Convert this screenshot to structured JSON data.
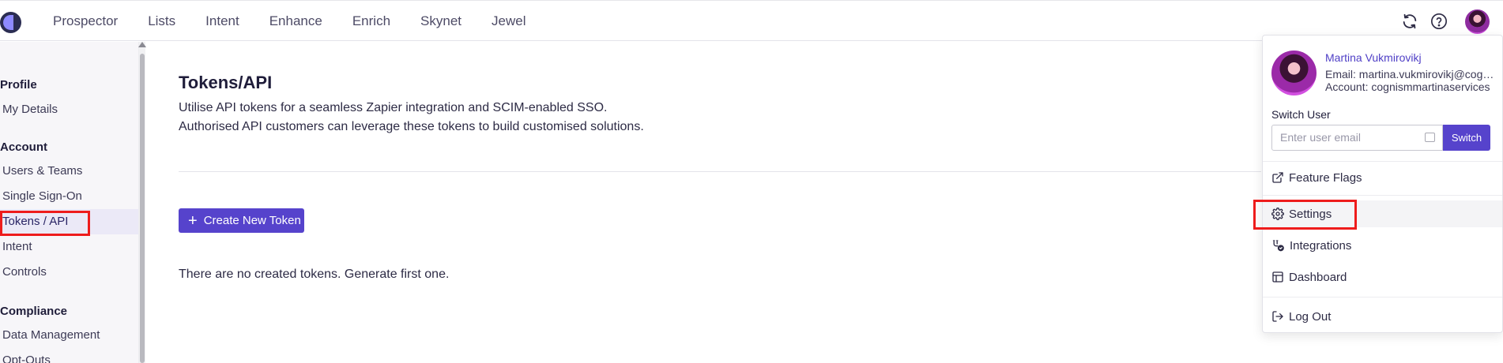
{
  "nav": {
    "items": [
      "Prospector",
      "Lists",
      "Intent",
      "Enhance",
      "Enrich",
      "Skynet",
      "Jewel"
    ]
  },
  "top_icons": {
    "refresh": "refresh-icon",
    "help": "help-icon",
    "avatar": "user-avatar"
  },
  "sidebar": {
    "sections": [
      {
        "heading": "Profile",
        "items": [
          "My Details"
        ]
      },
      {
        "heading": "Account",
        "items": [
          "Users & Teams",
          "Single Sign-On",
          "Tokens / API",
          "Intent",
          "Controls"
        ]
      },
      {
        "heading": "Compliance",
        "items": [
          "Data Management",
          "Opt-Outs"
        ]
      }
    ],
    "active_item": "Tokens / API"
  },
  "main": {
    "title": "Tokens/API",
    "description_line1": "Utilise API tokens for a seamless Zapier integration and SCIM-enabled SSO.",
    "description_line2": "Authorised API customers can leverage these tokens to build customised solutions.",
    "create_button_label": "Create New Token",
    "empty_message": "There are no created tokens. Generate first one."
  },
  "user_menu": {
    "name": "Martina Vukmirovikj",
    "email": "Email: martina.vukmirovikj@cognism.com",
    "account": "Account: cognismmartinaservices",
    "switch_label": "Switch User",
    "switch_placeholder": "Enter user email",
    "switch_button": "Switch",
    "items": {
      "feature_flags": "Feature Flags",
      "settings": "Settings",
      "integrations": "Integrations",
      "dashboard": "Dashboard",
      "logout": "Log Out"
    }
  },
  "colors": {
    "accent": "#5643cc",
    "highlight": "#ee1c1c",
    "name_link": "#4f3fc6"
  }
}
